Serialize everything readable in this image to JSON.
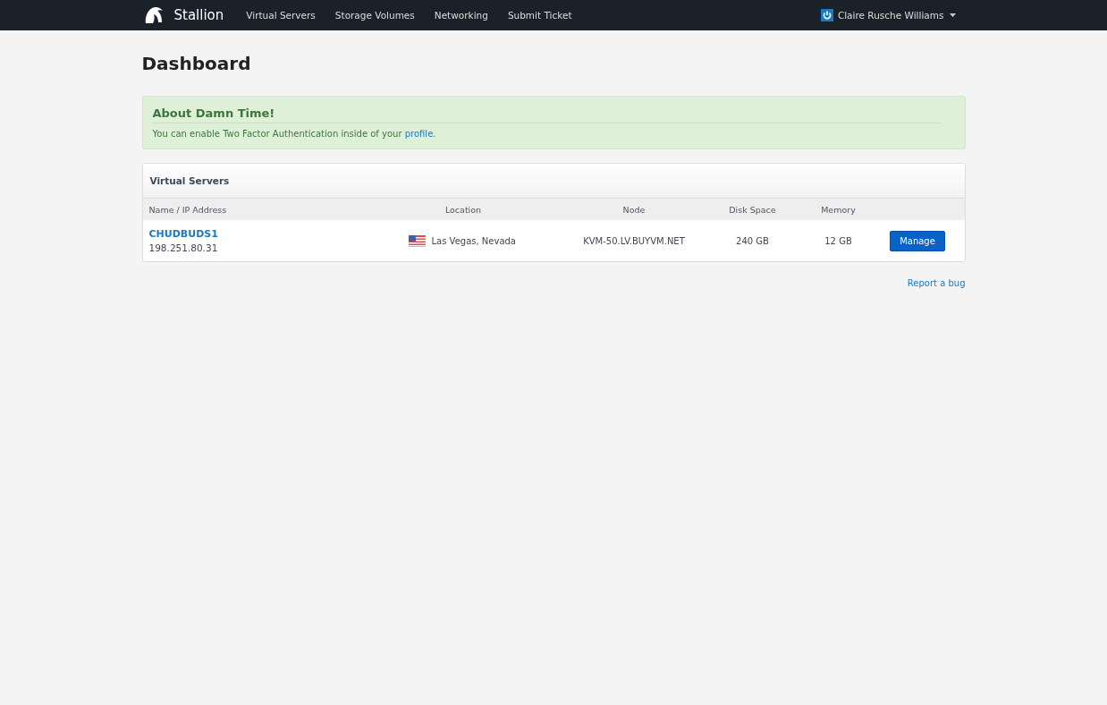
{
  "navbar": {
    "brand": "Stallion",
    "links": [
      "Virtual Servers",
      "Storage Volumes",
      "Networking",
      "Submit Ticket"
    ],
    "user": "Claire Rusche Williams"
  },
  "page_title": "Dashboard",
  "alert": {
    "title": "About Damn Time!",
    "text_before": "You can enable Two Factor Authentication inside of your ",
    "link": "profile",
    "text_after": "."
  },
  "panel": {
    "title": "Virtual Servers",
    "columns": [
      "Name / IP Address",
      "Location",
      "Node",
      "Disk Space",
      "Memory"
    ],
    "rows": [
      {
        "name": "CHUDBUDS1",
        "ip": "198.251.80.31",
        "location": "Las Vegas, Nevada",
        "node": "KVM-50.LV.BUYVM.NET",
        "disk": "240 GB",
        "memory": "12 GB",
        "action": "Manage"
      }
    ]
  },
  "footer_link": "Report a bug"
}
